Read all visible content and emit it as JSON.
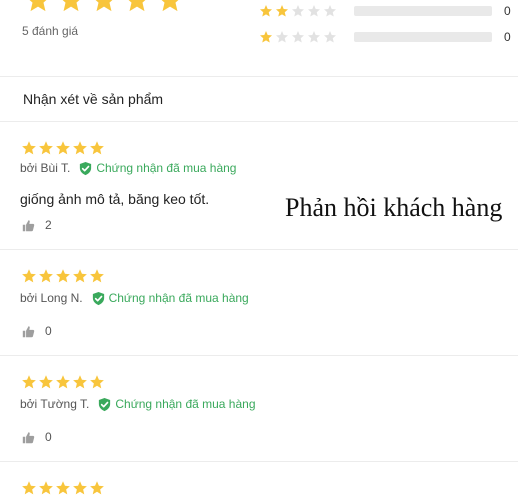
{
  "rating_summary": {
    "overall_stars": 5,
    "count_text": "5 đánh giá",
    "distribution": [
      {
        "stars": 2,
        "count": "0",
        "fraction": 0
      },
      {
        "stars": 1,
        "count": "0",
        "fraction": 0
      }
    ]
  },
  "section_title": "Nhận xét về sản phẩm",
  "overlay_title": "Phản hồi khách hàng",
  "reviews": [
    {
      "stars": 5,
      "author": "bởi Bùi T.",
      "verified": "Chứng nhận đã mua hàng",
      "text": "giống ảnh mô tả, băng keo tốt.",
      "likes": "2"
    },
    {
      "stars": 5,
      "author": "bởi Long N.",
      "verified": "Chứng nhận đã mua hàng",
      "text": "",
      "likes": "0"
    },
    {
      "stars": 5,
      "author": "bởi Tường T.",
      "verified": "Chứng nhận đã mua hàng",
      "text": "",
      "likes": "0"
    },
    {
      "stars": 5
    }
  ],
  "colors": {
    "star_filled": "#f8c53c",
    "star_empty": "#e2e2e2",
    "verified_green": "#3aa95c"
  },
  "icons": {
    "star": "star-icon",
    "verified": "verified-check-icon",
    "like": "thumbs-up-icon"
  }
}
